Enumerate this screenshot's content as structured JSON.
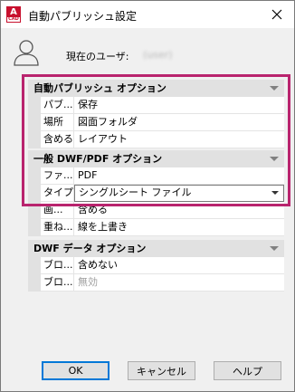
{
  "window": {
    "title": "自動パブリッシュ設定",
    "app_icon_letter": "A",
    "app_icon_sub": "CAD"
  },
  "user": {
    "label": "現在のユーザ:",
    "name": "(user)"
  },
  "groups": [
    {
      "header": "自動パブリッシュ オプション",
      "rows": [
        {
          "name": "パブ...",
          "value": "保存"
        },
        {
          "name": "場所",
          "value": "図面フォルダ"
        },
        {
          "name": "含める",
          "value": "レイアウト"
        }
      ]
    },
    {
      "header": "一般 DWF/PDF オプション",
      "rows": [
        {
          "name": "ファ...",
          "value": "PDF"
        },
        {
          "name": "タイプ",
          "value": "シングルシート ファイル"
        },
        {
          "name": "画...",
          "value": "含める"
        },
        {
          "name": "重ね...",
          "value": "線を上書き"
        }
      ]
    },
    {
      "header": "DWF データ オプション",
      "rows": [
        {
          "name": "ブロ...",
          "value": "含めない"
        },
        {
          "name": "ブロ...",
          "value": "無効"
        }
      ]
    }
  ],
  "buttons": {
    "ok": "OK",
    "cancel": "キャンセル",
    "help": "ヘルプ"
  },
  "colors": {
    "highlight": "#b9246e",
    "app_icon": "#c8102e"
  }
}
